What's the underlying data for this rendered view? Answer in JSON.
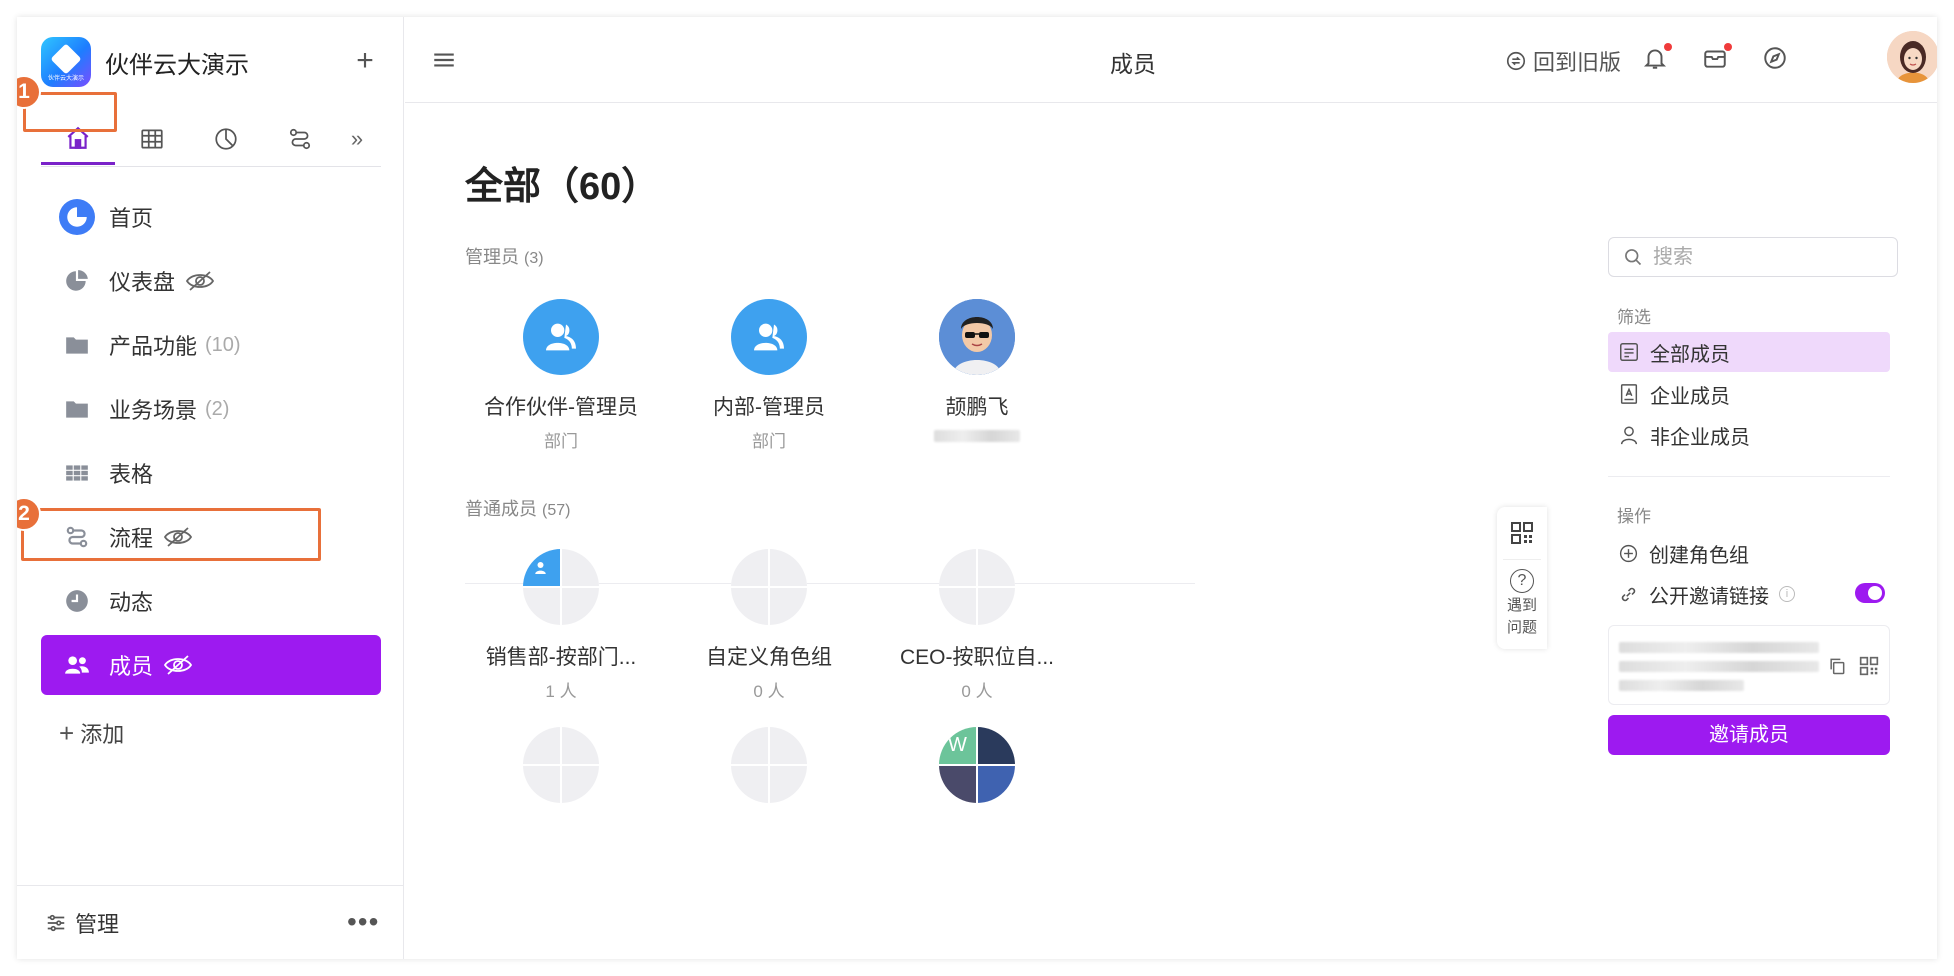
{
  "brand": {
    "name": "伙伴云大演示",
    "logo_text": "伙伴云大演示"
  },
  "sidebar": {
    "items": [
      {
        "label": "首页",
        "icon": "home-chart-icon"
      },
      {
        "label": "仪表盘",
        "icon": "pie-icon",
        "hidden": true
      },
      {
        "label": "产品功能",
        "count": "(10)",
        "icon": "folder-icon"
      },
      {
        "label": "业务场景",
        "count": "(2)",
        "icon": "folder-icon"
      },
      {
        "label": "表格",
        "icon": "table-icon"
      },
      {
        "label": "流程",
        "icon": "flow-icon",
        "hidden": true
      },
      {
        "label": "动态",
        "icon": "clock-icon"
      },
      {
        "label": "成员",
        "icon": "users-icon",
        "hidden": true,
        "active": true
      }
    ],
    "add_label": "添加",
    "manage_label": "管理",
    "more_label": "•••"
  },
  "annotations": [
    "1",
    "2"
  ],
  "topbar": {
    "title": "成员",
    "old_version": "回到旧版"
  },
  "main": {
    "heading": "全部（60）",
    "admins": {
      "label": "管理员",
      "count": "(3)",
      "cards": [
        {
          "name": "合作伙伴-管理员",
          "sub": "部门"
        },
        {
          "name": "内部-管理员",
          "sub": "部门"
        },
        {
          "name": "颉鹏飞",
          "sub": ""
        }
      ]
    },
    "members": {
      "label": "普通成员",
      "count": "(57)",
      "cards": [
        {
          "name": "销售部-按部门...",
          "sub": "1 人"
        },
        {
          "name": "自定义角色组",
          "sub": "0 人"
        },
        {
          "name": "CEO-按职位自...",
          "sub": "0 人"
        }
      ]
    }
  },
  "right_panel": {
    "search_placeholder": "搜索",
    "filter_label": "筛选",
    "filters": [
      "全部成员",
      "企业成员",
      "非企业成员"
    ],
    "ops_label": "操作",
    "ops": [
      "创建角色组",
      "公开邀请链接"
    ],
    "invite_toggle_on": true,
    "invite_button": "邀请成员"
  },
  "float": {
    "help_line1": "遇到",
    "help_line2": "问题"
  },
  "colors": {
    "accent": "#9d1af0",
    "annotation": "#e8703a",
    "blue": "#3ea1ef"
  }
}
